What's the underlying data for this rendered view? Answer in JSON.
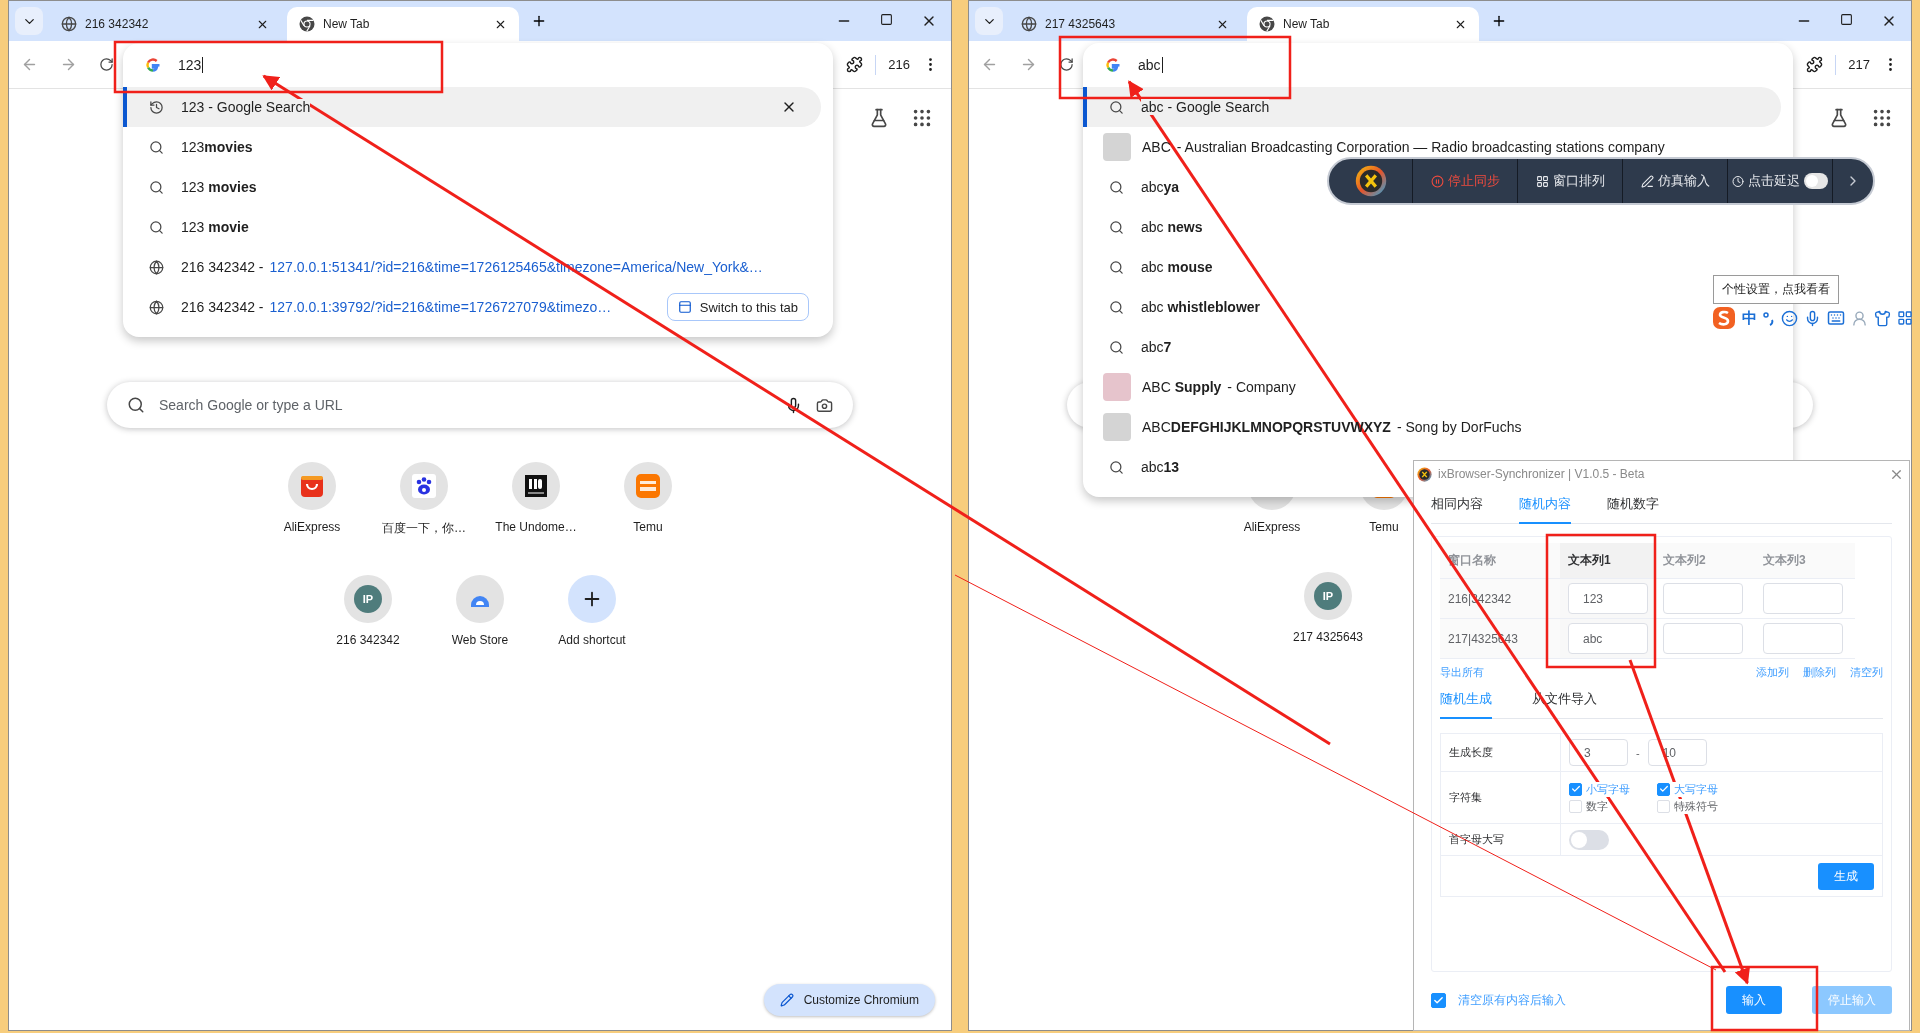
{
  "windows": [
    {
      "tabs": [
        {
          "label": "216 342342",
          "selected": false
        },
        {
          "label": "New Tab",
          "selected": true
        }
      ],
      "profile": "216",
      "omnibox": {
        "value": "123"
      },
      "suggestions": [
        {
          "kind": "history",
          "text": "123 - Google Search",
          "selected": true
        },
        {
          "kind": "search",
          "text": "123**movies**",
          "selected": false
        },
        {
          "kind": "search",
          "text": "123 **movies**",
          "selected": false
        },
        {
          "kind": "search",
          "text": "123 **movie**",
          "selected": false
        },
        {
          "kind": "url",
          "title": "216 342342 -",
          "url": "127.0.0.1:51341/?id=216&time=1726125465&timezone=America/New_York&…",
          "selected": false
        },
        {
          "kind": "url",
          "title": "216 342342 -",
          "url": "127.0.0.1:39792/?id=216&time=1726727079&timezo…",
          "action": "Switch to this tab",
          "selected": false
        }
      ],
      "search_box": {
        "placeholder": "Search Google or type a URL"
      },
      "shortcut_rows": [
        [
          {
            "label": "AliExpress",
            "kind": "shop"
          },
          {
            "label": "百度一下，你…",
            "kind": "paw"
          },
          {
            "label": "The Undome…",
            "kind": "bars"
          },
          {
            "label": "Temu",
            "kind": "stripes"
          }
        ],
        [
          {
            "label": "216 342342",
            "kind": "letter",
            "badge": "IP"
          },
          {
            "label": "Web Store",
            "kind": "arc"
          },
          {
            "label": "Add shortcut",
            "kind": "add"
          }
        ]
      ],
      "customize_button": "Customize Chromium"
    },
    {
      "tabs": [
        {
          "label": "217 4325643",
          "selected": false
        },
        {
          "label": "New Tab",
          "selected": true
        }
      ],
      "profile": "217",
      "omnibox": {
        "value": "abc"
      },
      "suggestions": [
        {
          "kind": "search",
          "text": "abc - Google Search",
          "selected": true
        },
        {
          "kind": "entity",
          "title": "ABC",
          "detail": "- Australian Broadcasting Corporation — Radio broadcasting stations company",
          "color": "#d4d4d4",
          "selected": false
        },
        {
          "kind": "search",
          "text": "abc**ya**",
          "selected": false
        },
        {
          "kind": "search",
          "text": "abc **news**",
          "selected": false
        },
        {
          "kind": "search",
          "text": "abc **mouse**",
          "selected": false
        },
        {
          "kind": "search",
          "text": "abc **whistleblower**",
          "selected": false
        },
        {
          "kind": "search",
          "text": "abc**7**",
          "selected": false
        },
        {
          "kind": "entity",
          "title": "ABC **Supply**",
          "detail": "- Company",
          "color": "#e6c4cc",
          "selected": false
        },
        {
          "kind": "entity",
          "title": "ABC**DEFGHIJKLMNOPQRSTUVWXYZ**",
          "detail": "- Song by DorFuchs",
          "color": "#d4d4d4",
          "selected": false
        },
        {
          "kind": "search",
          "text": "abc**13**",
          "selected": false
        }
      ],
      "shortcut_rows": [
        [
          {
            "label": "AliExpress",
            "kind": "shop"
          },
          {
            "label": "Temu",
            "kind": "stripes"
          }
        ],
        [
          {
            "label": "217 4325643",
            "kind": "letter",
            "badge": "IP"
          }
        ]
      ]
    }
  ],
  "sync_toolbar": {
    "items": [
      {
        "kind": "stop",
        "label": "停止同步"
      },
      {
        "kind": "button",
        "label": "窗口排列"
      },
      {
        "kind": "button",
        "label": "仿真输入"
      },
      {
        "kind": "toggle",
        "label": "点击延迟",
        "on": false
      }
    ]
  },
  "ime": {
    "tooltip": "个性设置，点我看看",
    "mode": "中"
  },
  "synchronizer": {
    "title": "ixBrowser-Synchronizer | V1.0.5 - Beta",
    "tabs": [
      {
        "label": "相同内容",
        "selected": false
      },
      {
        "label": "随机内容",
        "selected": true
      },
      {
        "label": "随机数字",
        "selected": false
      }
    ],
    "columns": [
      {
        "label": "窗口名称",
        "selected": false
      },
      {
        "label": "文本列1",
        "selected": true
      },
      {
        "label": "文本列2",
        "selected": false
      },
      {
        "label": "文本列3",
        "selected": false
      }
    ],
    "rows": [
      {
        "name": "216|342342",
        "values": [
          "123"
        ]
      },
      {
        "name": "217|4325643",
        "values": [
          "abc"
        ]
      }
    ],
    "export_link": "导出所有",
    "column_links": [
      "添加列",
      "删除列",
      "清空列"
    ],
    "sub_tabs": [
      {
        "label": "随机生成",
        "selected": true
      },
      {
        "label": "从文件导入",
        "selected": false
      }
    ],
    "length": {
      "label": "生成长度",
      "min": "3",
      "separator": "-",
      "max": "10"
    },
    "charset": {
      "label": "字符集",
      "options": [
        {
          "label": "小写字母",
          "checked": true
        },
        {
          "label": "大写字母",
          "checked": true
        },
        {
          "label": "数字",
          "checked": false
        },
        {
          "label": "特殊符号",
          "checked": false
        }
      ]
    },
    "capitalize": {
      "label": "首字母大写",
      "on": false
    },
    "generate_button": "生成",
    "clear_before": {
      "label": "清空原有内容后输入",
      "checked": true
    },
    "input_button": {
      "label": "输入",
      "disabled": false
    },
    "stop_button": {
      "label": "停止输入",
      "disabled": true
    }
  }
}
